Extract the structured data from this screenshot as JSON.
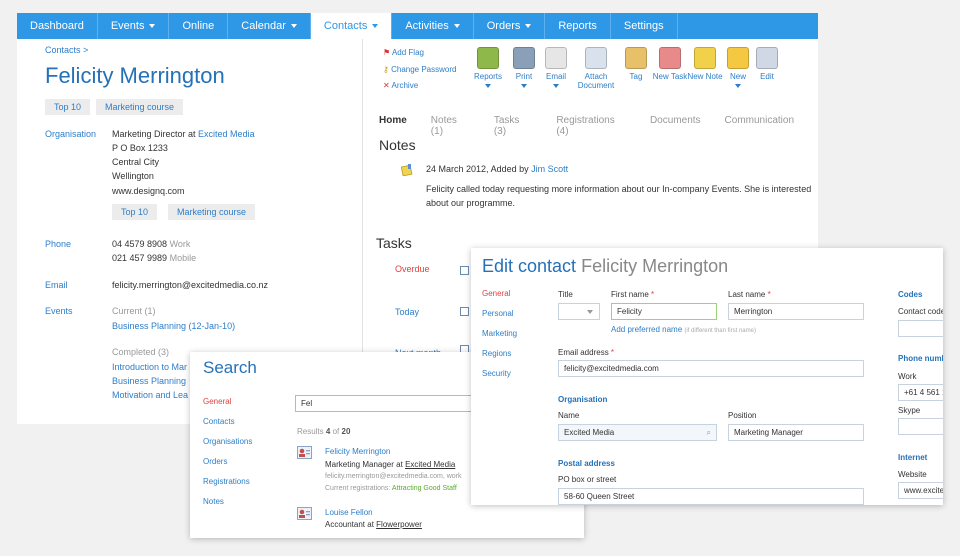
{
  "nav": {
    "items": [
      {
        "label": "Dashboard",
        "caret": false
      },
      {
        "label": "Events",
        "caret": true
      },
      {
        "label": "Online",
        "caret": false
      },
      {
        "label": "Calendar",
        "caret": true
      },
      {
        "label": "Contacts",
        "caret": true,
        "active": true
      },
      {
        "label": "Activities",
        "caret": true
      },
      {
        "label": "Orders",
        "caret": true
      },
      {
        "label": "Reports",
        "caret": false
      },
      {
        "label": "Settings",
        "caret": false
      }
    ]
  },
  "contact": {
    "breadcrumb": "Contacts >",
    "name": "Felicity Merrington",
    "tags": [
      "Top 10",
      "Marketing course"
    ],
    "organisation_label": "Organisation",
    "org_role": "Marketing Director at",
    "org_name": "Excited Media",
    "address": [
      "P O Box 1233",
      "Central City",
      "Wellington",
      "www.designq.com"
    ],
    "org_tags": [
      "Top 10",
      "Marketing course"
    ],
    "phone_label": "Phone",
    "phone_work": "04 4579 8908",
    "phone_work_type": "Work",
    "phone_mobile": "021 457 9989",
    "phone_mobile_type": "Mobile",
    "email_label": "Email",
    "email": "felicity.merrington@excitedmedia.co.nz",
    "events_label": "Events",
    "events_current": "Current (1)",
    "events_current_item": "Business Planning (12-Jan-10)",
    "events_completed": "Completed (3)",
    "events_completed_items": [
      "Introduction to Mar",
      "Business Planning",
      "Motivation and Lea"
    ]
  },
  "toolbar": {
    "add_flag": "Add Flag",
    "change_password": "Change Password",
    "archive": "Archive",
    "buttons": [
      {
        "label": "Reports",
        "caret": true
      },
      {
        "label": "Print",
        "caret": true
      },
      {
        "label": "Email",
        "caret": true
      },
      {
        "label": "Attach Document",
        "caret": false
      },
      {
        "label": "Tag",
        "caret": false
      },
      {
        "label": "New Task",
        "caret": false
      },
      {
        "label": "New Note",
        "caret": false
      },
      {
        "label": "New",
        "caret": true
      },
      {
        "label": "Edit",
        "caret": false
      }
    ]
  },
  "tabs": [
    "Home",
    "Notes (1)",
    "Tasks (3)",
    "Registrations (4)",
    "Documents",
    "Communication"
  ],
  "notes": {
    "title": "Notes",
    "date": "24 March 2012,",
    "added_by_label": "Added by",
    "added_by": "Jim Scott",
    "body_line1": "Felicity called today requesting more information about our In-company Events.  She is interested",
    "body_line2": "about our programme."
  },
  "tasks": {
    "title": "Tasks",
    "rows": [
      "Overdue",
      "Today",
      "Next month"
    ]
  },
  "search": {
    "title": "Search",
    "sidebar": [
      "General",
      "Contacts",
      "Organisations",
      "Orders",
      "Registrations",
      "Notes"
    ],
    "query": "Fel",
    "results_prefix": "Results",
    "results_count": "4",
    "results_of": "of",
    "results_total": "20",
    "result1_name": "Felicity Merrington",
    "result1_role": "Marketing Manager at",
    "result1_org": "Excited Media",
    "result1_email": "felicity.merrington@excitedmedia.com, work",
    "result1_reg_label": "Current registrations:",
    "result1_reg": "Attracting Good Staff",
    "result2_name": "Louise Fellon",
    "result2_role": "Accountant at",
    "result2_org": "Flowerpower"
  },
  "edit": {
    "title": "Edit contact",
    "name": "Felicity Merrington",
    "sidebar": [
      "General",
      "Personal",
      "Marketing",
      "Regions",
      "Security"
    ],
    "title_label": "Title",
    "first_name_label": "First name",
    "first_name": "Felicity",
    "last_name_label": "Last name",
    "last_name": "Merrington",
    "add_preferred": "Add preferred name",
    "add_preferred_hint": "(if different than first name)",
    "email_label": "Email address",
    "email": "felicity@excitedmedia.com",
    "organisation_hdr": "Organisation",
    "org_name_label": "Name",
    "org_name": "Excited Media",
    "position_label": "Position",
    "position": "Marketing Manager",
    "postal_hdr": "Postal address",
    "po_label": "PO box or street",
    "po_value": "58-60 Queen Street",
    "codes_hdr": "Codes",
    "contact_code_label": "Contact code",
    "phone_hdr": "Phone numb",
    "work_label": "Work",
    "work_value": "+61 4 561 1",
    "skype_label": "Skype",
    "internet_hdr": "Internet",
    "website_label": "Website",
    "website_value": "www.excite"
  },
  "colors": {
    "nav": "#2e97e6",
    "link": "#2d7ec9",
    "overdue": "#e04040",
    "success": "#5aab2e"
  }
}
